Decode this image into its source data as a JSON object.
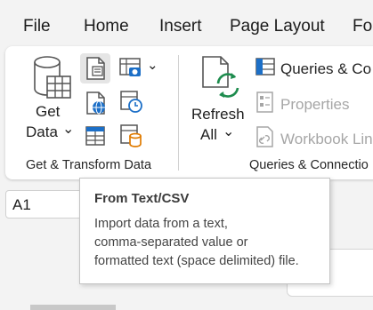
{
  "menu": {
    "tabs": [
      "File",
      "Home",
      "Insert",
      "Page Layout",
      "Fo"
    ]
  },
  "ribbon": {
    "get_data": {
      "line1": "Get",
      "line2": "Data",
      "chevron": "⌄",
      "icon": "database-table-icon"
    },
    "get_transform_small_icons": [
      "from-text-csv-icon",
      "from-web-icon",
      "from-table-range-icon",
      "from-picture-icon",
      "recent-sources-icon",
      "existing-connections-icon"
    ],
    "picture_dropdown_chevron": "⌄",
    "group_get_transform": "Get & Transform Data",
    "refresh_all": {
      "line1": "Refresh",
      "line2": "All",
      "chevron": "⌄",
      "icon": "refresh-icon"
    },
    "queries_connections": {
      "label": "Queries & Co",
      "icon": "queries-connections-icon"
    },
    "properties": {
      "label": "Properties",
      "icon": "properties-icon"
    },
    "workbook_links": {
      "label": "Workbook Lin",
      "icon": "workbook-links-icon"
    },
    "group_queries": "Queries & Connectio"
  },
  "formula_bar": {
    "name_box": "A1"
  },
  "tooltip": {
    "title": "From Text/CSV",
    "lines": [
      "Import data from a text,",
      "comma-separated value or",
      "formatted text (space delimited) file."
    ]
  },
  "colors": {
    "accent_green": "#1e8c4e",
    "accent_blue": "#1c6fc7",
    "accent_orange": "#e07b00",
    "disabled_gray": "#a6a6a6"
  }
}
